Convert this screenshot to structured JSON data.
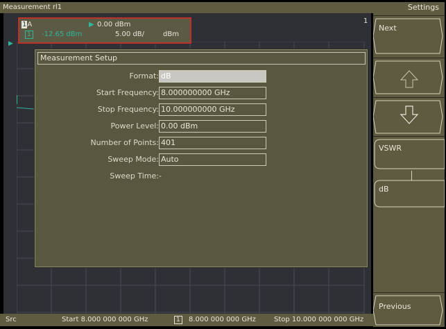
{
  "window": {
    "title": "Measurement rl1"
  },
  "marker": {
    "trace_id": "1",
    "trace_letter": "A",
    "ref_level": "0.00 dBm",
    "marker_number": "1",
    "marker_value": "-12.65 dBm",
    "scale": "5.00 dB/",
    "unit": "dBm"
  },
  "channel_number": "1",
  "dialog": {
    "title": "Measurement Setup",
    "fields": [
      {
        "label": "Format:",
        "value": "dB"
      },
      {
        "label": "Start Frequency:",
        "value": "8.000000000 GHz"
      },
      {
        "label": "Stop Frequency:",
        "value": "10.000000000 GHz"
      },
      {
        "label": "Power Level:",
        "value": "0.00 dBm"
      },
      {
        "label": "Number of Points:",
        "value": "401"
      },
      {
        "label": "Sweep Mode:",
        "value": "Auto"
      },
      {
        "label": "Sweep Time:",
        "value": "-"
      }
    ]
  },
  "settings": {
    "header": "Settings",
    "next_label": "Next",
    "option1_label": "VSWR",
    "option2_label": "dB",
    "previous_label": "Previous"
  },
  "status": {
    "src": "Src",
    "start": "Start 8.000 000 000 GHz",
    "marker_num": "1",
    "marker_freq": "8.000 000 000 GHz",
    "stop": "Stop 10.000 000 000 GHz"
  },
  "colors": {
    "panel": "#5e5b40",
    "trace": "#2fb59a",
    "marker_box_border": "#c0302a",
    "plot_bg": "#2f2f36"
  }
}
